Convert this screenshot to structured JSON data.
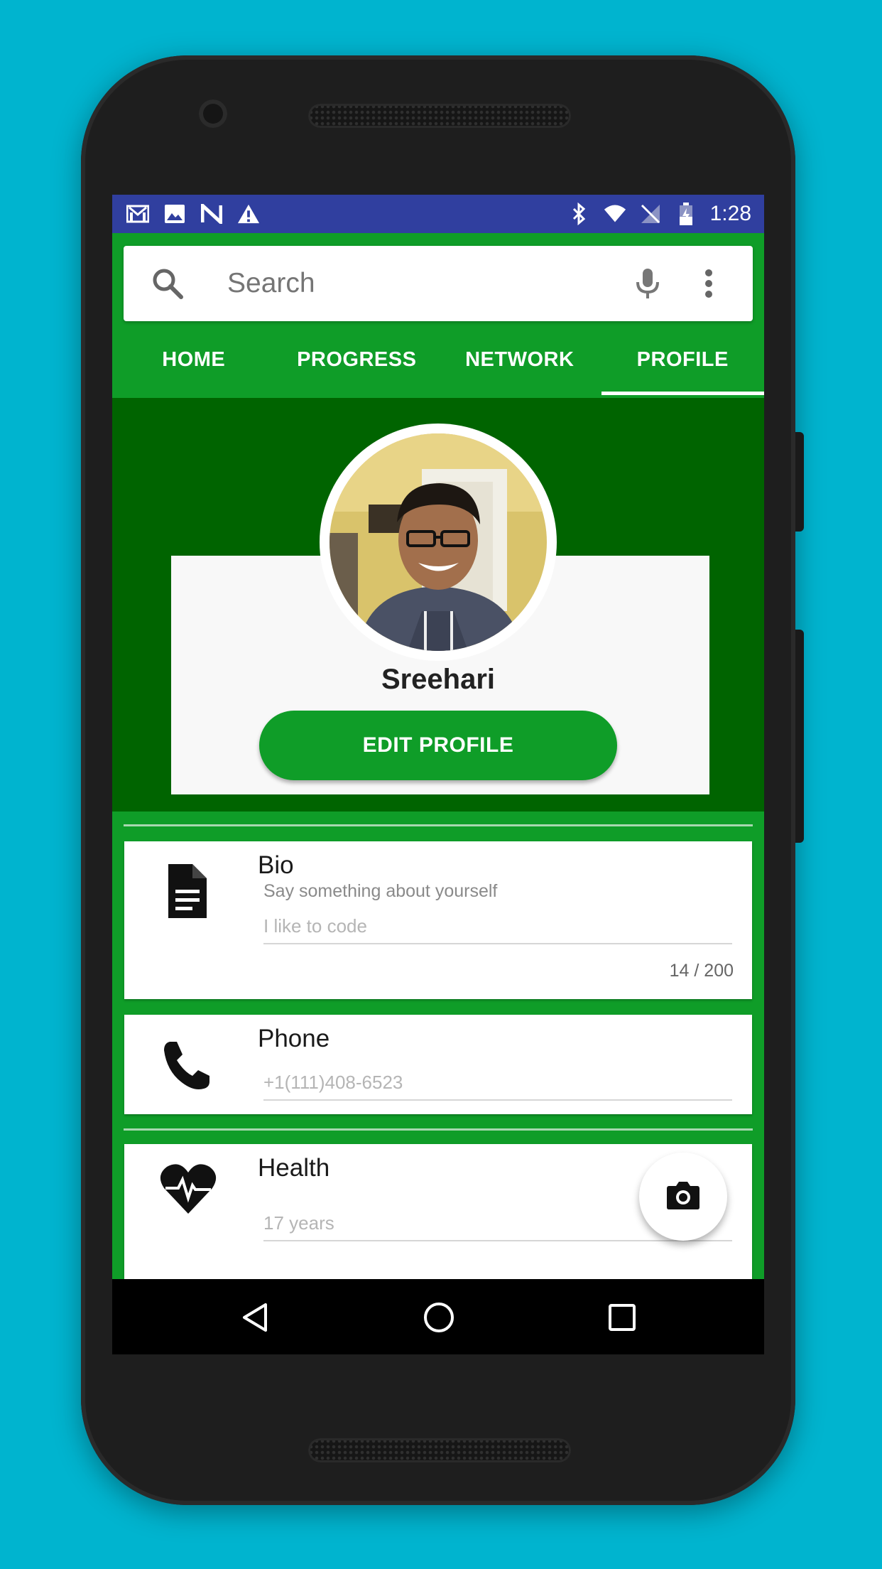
{
  "status_bar": {
    "time": "1:28",
    "left_icons": [
      "gmail-icon",
      "image-icon",
      "n-icon",
      "warning-icon"
    ],
    "right_icons": [
      "bluetooth-icon",
      "wifi-icon",
      "no-sim-icon",
      "battery-icon"
    ]
  },
  "search": {
    "placeholder": "Search"
  },
  "tabs": [
    {
      "label": "HOME",
      "active": false
    },
    {
      "label": "PROGRESS",
      "active": false
    },
    {
      "label": "NETWORK",
      "active": false
    },
    {
      "label": "PROFILE",
      "active": true
    }
  ],
  "profile": {
    "name": "Sreehari",
    "edit_label": "EDIT PROFILE"
  },
  "cards": {
    "bio": {
      "title": "Bio",
      "hint": "Say something about yourself",
      "value": "I like to code",
      "counter": "14 / 200"
    },
    "phone": {
      "title": "Phone",
      "value": "+1(111)408-6523"
    },
    "health": {
      "title": "Health",
      "value": "17 years"
    }
  },
  "colors": {
    "background": "#00b4cf",
    "primary_green": "#0f9d28",
    "dark_green": "#006400",
    "status_bar": "#303f9f"
  }
}
